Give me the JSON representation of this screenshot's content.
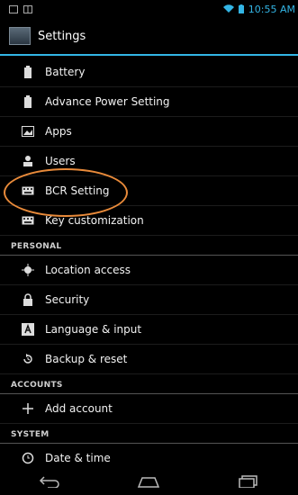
{
  "status": {
    "time": "10:55 AM"
  },
  "title": "Settings",
  "items": [
    {
      "label": "Battery",
      "icon": "battery-icon"
    },
    {
      "label": "Advance Power Setting",
      "icon": "battery-icon"
    },
    {
      "label": "Apps",
      "icon": "apps-icon"
    },
    {
      "label": "Users",
      "icon": "users-icon"
    },
    {
      "label": "BCR Setting",
      "icon": "keyboard-icon"
    },
    {
      "label": "Key customization",
      "icon": "keyboard-icon"
    }
  ],
  "sections": {
    "personal": "PERSONAL",
    "accounts": "ACCOUNTS",
    "system": "SYSTEM"
  },
  "personal_items": [
    {
      "label": "Location access",
      "icon": "location-icon"
    },
    {
      "label": "Security",
      "icon": "lock-icon"
    },
    {
      "label": "Language & input",
      "icon": "language-icon"
    },
    {
      "label": "Backup & reset",
      "icon": "backup-icon"
    }
  ],
  "accounts_items": [
    {
      "label": "Add account",
      "icon": "add-icon"
    }
  ],
  "system_items": [
    {
      "label": "Date & time",
      "icon": "clock-icon"
    }
  ],
  "colors": {
    "accent": "#33b5e5",
    "highlight": "#e88a3a"
  }
}
